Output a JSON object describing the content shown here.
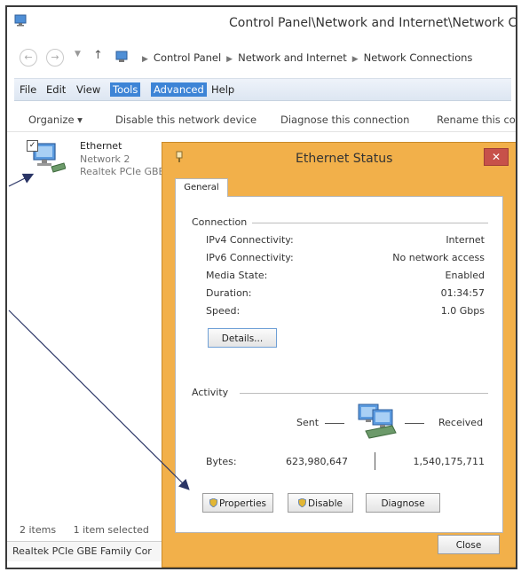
{
  "window": {
    "title": "Control Panel\\Network and Internet\\Network C"
  },
  "address_bar": {
    "breadcrumbs": [
      "Control Panel",
      "Network and Internet",
      "Network Connections"
    ]
  },
  "menu": {
    "file": "File",
    "edit": "Edit",
    "view": "View",
    "tools": "Tools",
    "advanced": "Advanced",
    "help": "Help"
  },
  "commands": {
    "organize": "Organize ▾",
    "disable": "Disable this network device",
    "diagnose": "Diagnose this connection",
    "rename": "Rename this co"
  },
  "connection_item": {
    "name": "Ethernet",
    "network": "Network  2",
    "adapter": "Realtek PCIe GBE"
  },
  "status_bar": {
    "count": "2 items",
    "selected": "1 item selected"
  },
  "bottom_bar": {
    "text": "Realtek PCIe GBE Family Cor"
  },
  "dialog": {
    "title": "Ethernet Status",
    "close_glyph": "✕",
    "tab_general": "General",
    "connection_group": "Connection",
    "rows": [
      {
        "label": "IPv4 Connectivity:",
        "value": "Internet"
      },
      {
        "label": "IPv6 Connectivity:",
        "value": "No network access"
      },
      {
        "label": "Media State:",
        "value": "Enabled"
      },
      {
        "label": "Duration:",
        "value": "01:34:57"
      },
      {
        "label": "Speed:",
        "value": "1.0 Gbps"
      }
    ],
    "details_button": "Details...",
    "activity_group": "Activity",
    "sent_label": "Sent",
    "received_label": "Received",
    "bytes_label": "Bytes:",
    "bytes_sent": "623,980,647",
    "bytes_received": "1,540,175,711",
    "properties_button": "Properties",
    "disable_button": "Disable",
    "diagnose_button": "Diagnose",
    "close_button": "Close"
  },
  "colors": {
    "dialog_frame": "#f2b04a",
    "menu_highlight": "#3d84d6",
    "close_red": "#c7514a",
    "arrow": "#2a3566"
  }
}
